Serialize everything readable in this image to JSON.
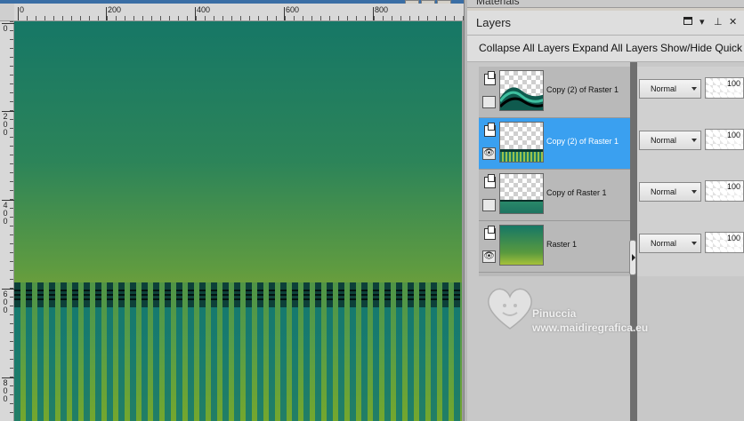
{
  "rulers": {
    "horizontal": [
      "0",
      "200",
      "400",
      "600",
      "800"
    ],
    "vertical": [
      [
        "0"
      ],
      [
        "2",
        "0",
        "0"
      ],
      [
        "4",
        "0",
        "0"
      ],
      [
        "6",
        "0",
        "0"
      ],
      [
        "8",
        "0",
        "0"
      ]
    ]
  },
  "materials_panel": {
    "title": "Materials"
  },
  "layers_panel": {
    "title": "Layers",
    "toolbar": {
      "collapse_all": "Collapse All Layers",
      "expand_all": "Expand All Layers",
      "show_hide_quick": "Show/Hide Quick"
    },
    "layers": [
      {
        "name": "Copy (2) of Raster 1",
        "visible": false,
        "selected": false,
        "blend": "Normal",
        "opacity": "100",
        "thumb": "green-wave-icon"
      },
      {
        "name": "Copy (2) of Raster 1",
        "visible": true,
        "selected": true,
        "blend": "Normal",
        "opacity": "100",
        "thumb": "stripes-icon"
      },
      {
        "name": "Copy of Raster 1",
        "visible": false,
        "selected": false,
        "blend": "Normal",
        "opacity": "100",
        "thumb": "green-band-icon"
      },
      {
        "name": "Raster 1",
        "visible": true,
        "selected": false,
        "blend": "Normal",
        "opacity": "100",
        "thumb": "gradient-icon"
      }
    ],
    "icons": {
      "eye": "👁",
      "pin": "⊥",
      "menu_arrow": "▾",
      "close": "✕"
    }
  },
  "watermark": {
    "name": "Pinuccia",
    "url": "www.maidiregrafica.eu"
  },
  "colors": {
    "selection": "#3aa0f0",
    "gradient_top": "#167766",
    "gradient_bottom": "#6b9e3c"
  }
}
